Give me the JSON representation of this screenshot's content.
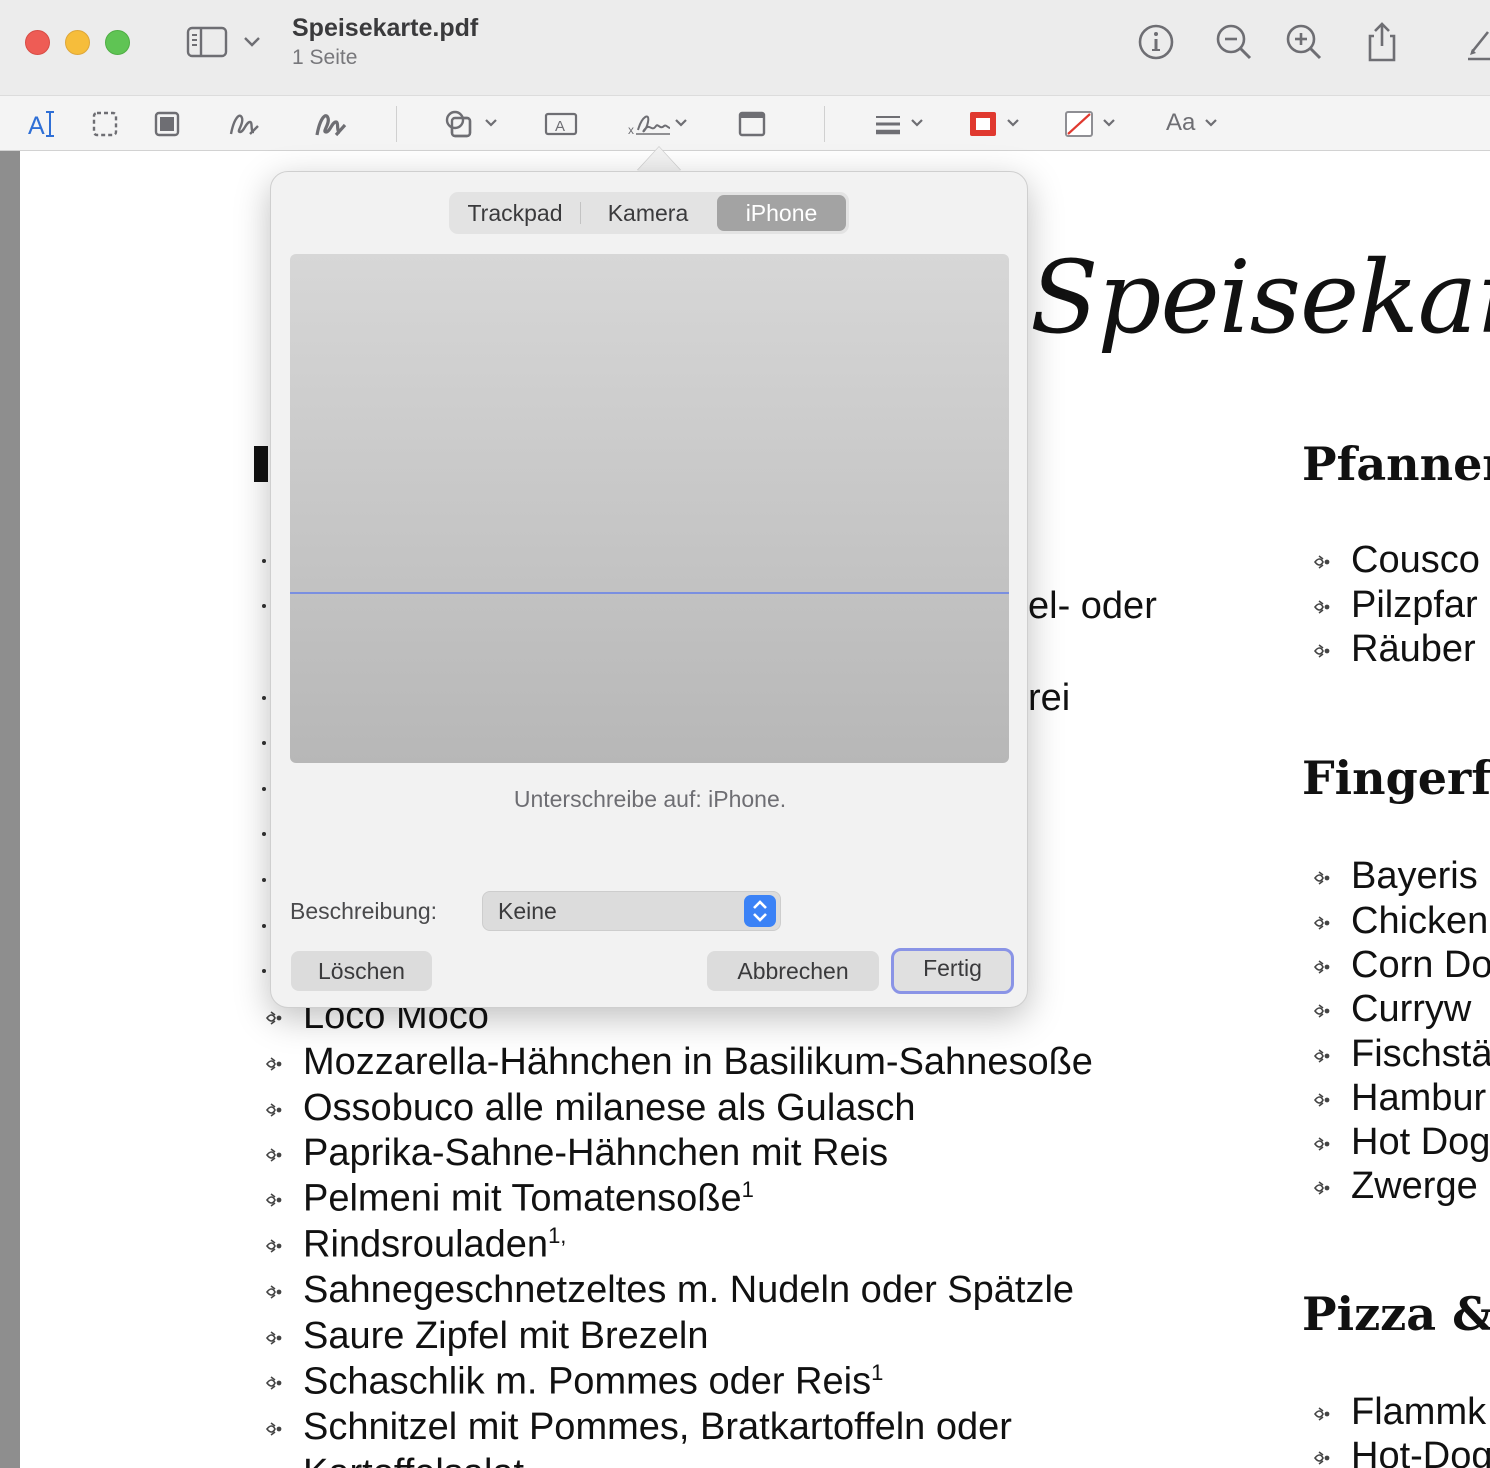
{
  "window": {
    "title": "Speisekarte.pdf",
    "subtitle": "1 Seite"
  },
  "markup_toolbar": {
    "text_style_label": "Aa"
  },
  "document": {
    "title": "Speisekarte",
    "sections": {
      "pfanne": "Pfanner",
      "finger": "Fingerfo",
      "pizza": "Pizza &"
    },
    "left_fragments": {
      "f1": "el- oder",
      "f2": "rei"
    },
    "left_items": [
      "Loco Moco",
      "Mozzarella-Hähnchen in Basilikum-Sahnesoße",
      "Ossobuco alle milanese als Gulasch",
      "Paprika-Sahne-Hähnchen mit Reis",
      "Pelmeni mit Tomatensoße",
      "Rindsrouladen",
      "Sahnegeschnetzeltes m. Nudeln oder Spätzle",
      "Saure Zipfel mit Brezeln",
      "Schaschlik m. Pommes oder Reis",
      "Schnitzel mit Pommes, Bratkartoffeln oder",
      "Kartoffelsalat"
    ],
    "superscripts": {
      "pelmeni": "1",
      "rinds": "1,",
      "schaschlik": "1"
    },
    "right_pfanne_items": [
      "Cousco",
      "Pilzpfar",
      "Räuber"
    ],
    "right_finger_items": [
      "Bayeris",
      "Chicken",
      "Corn Do",
      "Curryw",
      "Fischstä",
      "Hambur",
      "Hot Dog",
      "Zwerge"
    ],
    "right_pizza_items": [
      "Flammk",
      "Hot-Dog"
    ]
  },
  "signature_popover": {
    "tabs": [
      "Trackpad",
      "Kamera",
      "iPhone"
    ],
    "selected_tab": "iPhone",
    "hint": "Unterschreibe auf: iPhone.",
    "description_label": "Beschreibung:",
    "description_value": "Keine",
    "delete_label": "Löschen",
    "cancel_label": "Abbrechen",
    "done_label": "Fertig"
  },
  "colors": {
    "accent": "#3b82f6",
    "close": "#ee5c55",
    "minimize": "#f6bd3b",
    "maximize": "#5fc454",
    "border_color_tool": "#e0392f",
    "signature_baseline": "#7a8fe0"
  }
}
